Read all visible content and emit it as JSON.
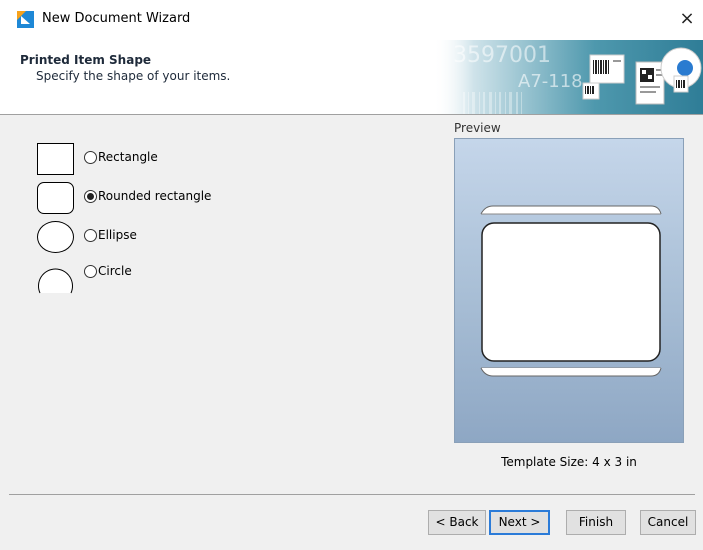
{
  "window": {
    "title": "New Document Wizard",
    "close_glyph": "×",
    "app_icon": "nicelabel-logo-icon"
  },
  "header": {
    "title": "Printed Item Shape",
    "subtitle": "Specify the shape of your items.",
    "banner_text_1": "3597001",
    "banner_text_2": "A7-118"
  },
  "shapes": [
    {
      "label": "Rectangle",
      "selected": false
    },
    {
      "label": "Rounded rectangle",
      "selected": true
    },
    {
      "label": "Ellipse",
      "selected": false
    },
    {
      "label": "Circle",
      "selected": false
    }
  ],
  "preview": {
    "label": "Preview",
    "template_size": "Template Size:  4 x 3 in"
  },
  "buttons": {
    "back": "< Back",
    "next": "Next >",
    "finish": "Finish",
    "cancel": "Cancel"
  },
  "colors": {
    "accent": "#2b7bd8",
    "logo_orange": "#f7a21b",
    "logo_blue": "#1e88d6"
  }
}
